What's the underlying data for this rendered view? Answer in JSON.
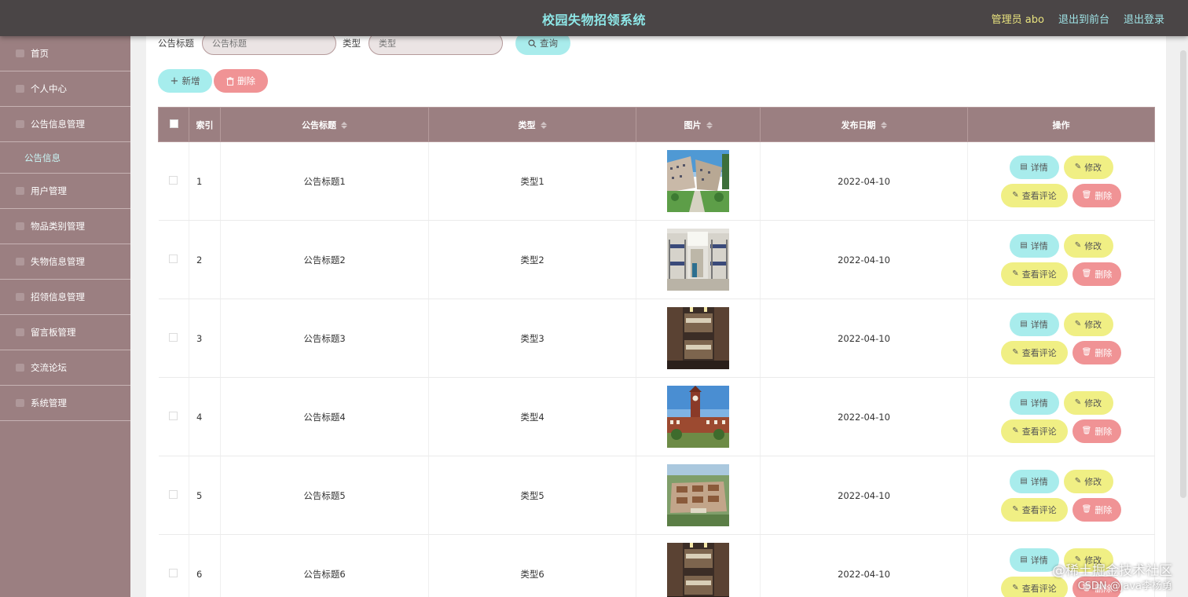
{
  "header": {
    "title": "校园失物招领系统",
    "admin_label": "管理员 abo",
    "back_label": "退出到前台",
    "logout_label": "退出登录"
  },
  "sidebar": {
    "items": [
      {
        "label": "首页"
      },
      {
        "label": "个人中心"
      },
      {
        "label": "公告信息管理"
      },
      {
        "label": "公告信息",
        "sub": true
      },
      {
        "label": "用户管理"
      },
      {
        "label": "物品类别管理"
      },
      {
        "label": "失物信息管理"
      },
      {
        "label": "招领信息管理"
      },
      {
        "label": "留言板管理"
      },
      {
        "label": "交流论坛"
      },
      {
        "label": "系统管理"
      }
    ]
  },
  "search": {
    "title_label": "公告标题",
    "title_placeholder": "公告标题",
    "type_label": "类型",
    "type_placeholder": "类型",
    "query_label": "查询"
  },
  "toolbar": {
    "add_label": "新增",
    "delete_label": "删除"
  },
  "table": {
    "columns": [
      "索引",
      "公告标题",
      "类型",
      "图片",
      "发布日期",
      "操作"
    ],
    "rows": [
      {
        "index": "1",
        "title": "公告标题1",
        "type": "类型1",
        "image": "campus-buildings",
        "date": "2022-04-10"
      },
      {
        "index": "2",
        "title": "公告标题2",
        "type": "类型2",
        "image": "dorm-room-bunk-beds",
        "date": "2022-04-10"
      },
      {
        "index": "3",
        "title": "公告标题3",
        "type": "类型3",
        "image": "dorm-room-dark",
        "date": "2022-04-10"
      },
      {
        "index": "4",
        "title": "公告标题4",
        "type": "类型4",
        "image": "clock-tower",
        "date": "2022-04-10"
      },
      {
        "index": "5",
        "title": "公告标题5",
        "type": "类型5",
        "image": "campus-aerial",
        "date": "2022-04-10"
      },
      {
        "index": "6",
        "title": "公告标题6",
        "type": "类型6",
        "image": "dorm-room-dark",
        "date": "2022-04-10"
      }
    ],
    "actions": {
      "detail": "详情",
      "edit": "修改",
      "comment": "查看评论",
      "delete": "删除"
    }
  },
  "watermark": {
    "line1": "@稀土掘金技术社区",
    "line2": "CSDN @java李杨勇"
  },
  "colors": {
    "header_bg": "#4a4546",
    "sidebar_bg": "#9b7f81",
    "title_color": "#8ee8e8",
    "cyan_button": "#a8ecec",
    "yellow_button": "#f0ef84",
    "red_button": "#f09395"
  }
}
